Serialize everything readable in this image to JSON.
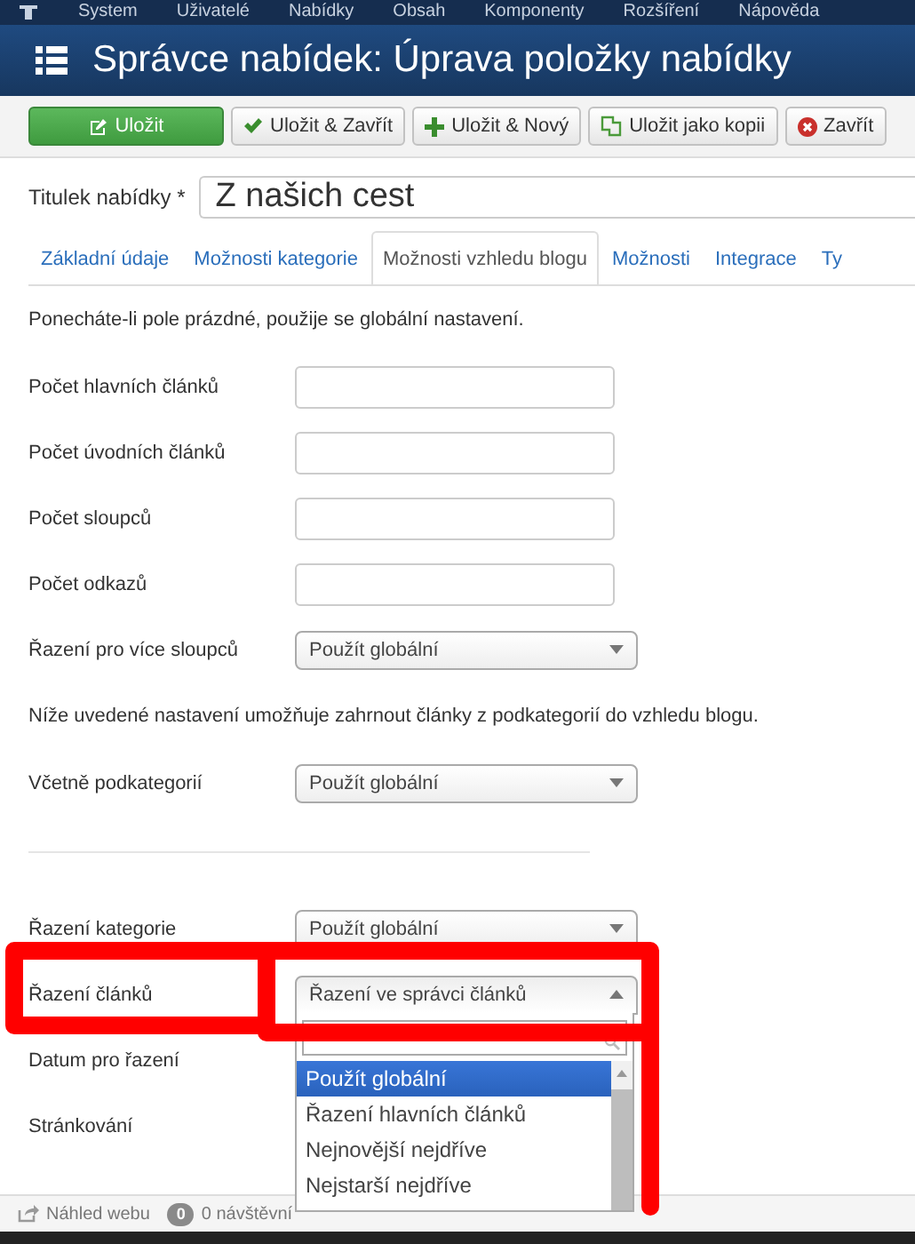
{
  "top_menu": [
    "System",
    "Uživatelé",
    "Nabídky",
    "Obsah",
    "Komponenty",
    "Rozšíření",
    "Nápověda"
  ],
  "header": {
    "title": "Správce nabídek: Úprava položky nabídky"
  },
  "toolbar": [
    {
      "label": "Uložit",
      "kind": "primary"
    },
    {
      "label": "Uložit & Zavřít",
      "kind": "check"
    },
    {
      "label": "Uložit & Nový",
      "kind": "plus"
    },
    {
      "label": "Uložit jako kopii",
      "kind": "copy"
    },
    {
      "label": "Zavřít",
      "kind": "close"
    }
  ],
  "title_field": {
    "label": "Titulek nabídky *",
    "value": "Z našich cest"
  },
  "tabs": [
    {
      "label": "Základní údaje",
      "selected": false
    },
    {
      "label": "Možnosti kategorie",
      "selected": false
    },
    {
      "label": "Možnosti vzhledu blogu",
      "selected": true
    },
    {
      "label": "Možnosti",
      "selected": false
    },
    {
      "label": "Integrace",
      "selected": false
    },
    {
      "label": "Ty",
      "selected": false
    }
  ],
  "form": [
    {
      "kind": "note",
      "text": "Ponecháte-li pole prázdné, použije se globální nastavení."
    },
    {
      "kind": "input",
      "label": "Počet hlavních článků"
    },
    {
      "kind": "input",
      "label": "Počet úvodních článků"
    },
    {
      "kind": "input",
      "label": "Počet sloupců"
    },
    {
      "kind": "input",
      "label": "Počet odkazů"
    },
    {
      "kind": "select",
      "label": "Řazení pro více sloupců",
      "value": "Použít globální"
    },
    {
      "kind": "note",
      "text": "Níže uvedené nastavení umožňuje zahrnout články z podkategorií do vzhledu blogu."
    },
    {
      "kind": "select",
      "label": "Včetně podkategorií",
      "value": "Použít globální"
    },
    {
      "kind": "divider"
    },
    {
      "kind": "select",
      "label": "Řazení kategorie",
      "value": "Použít globální"
    },
    {
      "kind": "select",
      "label": "Řazení článků",
      "value": "Řazení ve správci článků",
      "open": true,
      "highlighted": true,
      "options": [
        {
          "label": "Použít globální",
          "selected": true
        },
        {
          "label": "Řazení hlavních článků",
          "selected": false
        },
        {
          "label": "Nejnovější nejdříve",
          "selected": false
        },
        {
          "label": "Nejstarší nejdříve",
          "selected": false
        }
      ]
    },
    {
      "kind": "label",
      "label": "Datum pro řazení"
    },
    {
      "kind": "label",
      "label": "Stránkování"
    }
  ],
  "status_bar": {
    "preview": "Náhled webu",
    "badge": "0",
    "visitors": "0 návštěvní"
  }
}
